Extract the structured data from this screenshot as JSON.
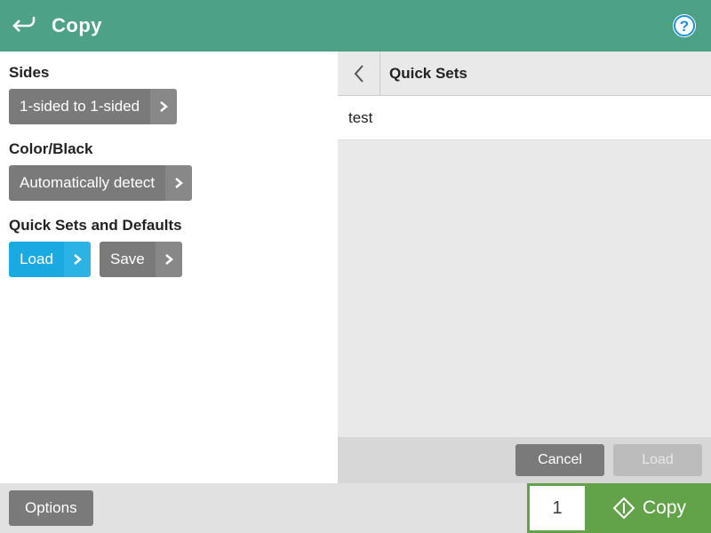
{
  "header": {
    "title": "Copy"
  },
  "left": {
    "sides_label": "Sides",
    "sides_value": "1-sided to 1-sided",
    "color_label": "Color/Black",
    "color_value": "Automatically detect",
    "quicksets_label": "Quick Sets and Defaults",
    "load_label": "Load",
    "save_label": "Save"
  },
  "quicksets": {
    "title": "Quick Sets",
    "items": [
      "test"
    ],
    "cancel_label": "Cancel",
    "load_label": "Load"
  },
  "footer": {
    "options_label": "Options",
    "copies": "1",
    "copy_label": "Copy"
  }
}
